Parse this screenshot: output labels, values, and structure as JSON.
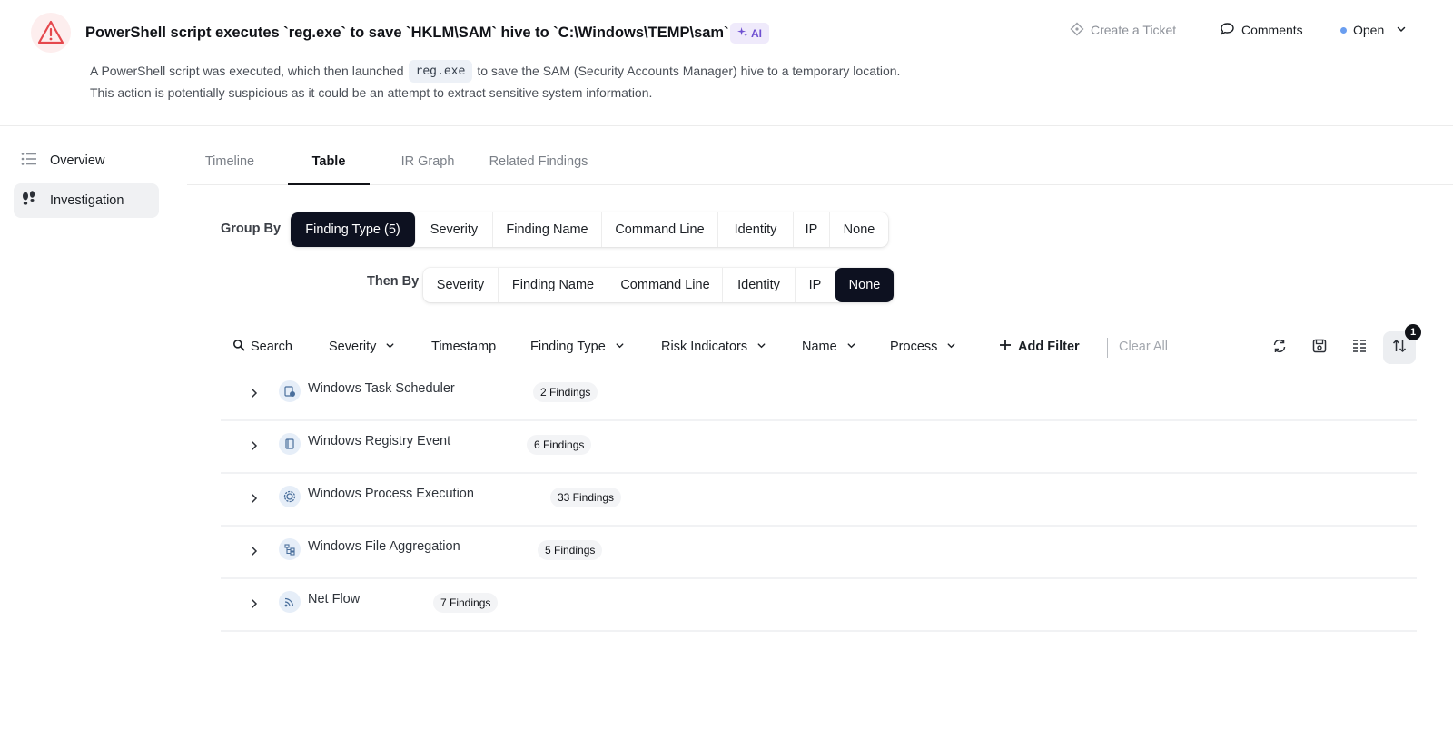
{
  "header": {
    "title": "PowerShell script executes `reg.exe` to save `HKLM\\SAM` hive to `C:\\Windows\\TEMP\\sam`",
    "ai_badge": "AI",
    "description_line1_pre": "A PowerShell script was executed, which then launched",
    "description_code": "reg.exe",
    "description_line1_post": "to save the SAM (Security Accounts Manager) hive to a temporary location.",
    "description_line2": "This action is potentially suspicious as it could be an attempt to extract sensitive system information.",
    "create_ticket": "Create a Ticket",
    "comments": "Comments",
    "status": "Open",
    "status_color": "#6a9ef0",
    "alert_color": "#e5484d"
  },
  "nav": {
    "items": [
      {
        "label": "Overview",
        "icon": "list-icon"
      },
      {
        "label": "Investigation",
        "icon": "footprints-icon",
        "active": true
      }
    ]
  },
  "tabs": [
    {
      "label": "Timeline"
    },
    {
      "label": "Table",
      "active": true
    },
    {
      "label": "IR Graph"
    },
    {
      "label": "Related Findings"
    }
  ],
  "group_by": {
    "label": "Group By",
    "options": [
      "Finding Type (5)",
      "Severity",
      "Finding Name",
      "Command Line",
      "Identity",
      "IP",
      "None"
    ],
    "selected": "Finding Type (5)"
  },
  "then_by": {
    "label": "Then By",
    "options": [
      "Severity",
      "Finding Name",
      "Command Line",
      "Identity",
      "IP",
      "None"
    ],
    "selected": "None"
  },
  "filters": {
    "search": "Search",
    "severity": "Severity",
    "timestamp": "Timestamp",
    "finding_type": "Finding Type",
    "risk_indicators": "Risk Indicators",
    "name": "Name",
    "process": "Process",
    "add_filter": "Add Filter",
    "clear_all": "Clear All",
    "sort_badge": "1"
  },
  "rows": [
    {
      "name": "Windows Task Scheduler",
      "count": "2 Findings",
      "icon": "task-scheduler-icon"
    },
    {
      "name": "Windows Registry Event",
      "count": "6 Findings",
      "icon": "registry-icon"
    },
    {
      "name": "Windows Process Execution",
      "count": "33 Findings",
      "icon": "process-gear-icon"
    },
    {
      "name": "Windows File Aggregation",
      "count": "5 Findings",
      "icon": "file-tree-icon"
    },
    {
      "name": "Net Flow",
      "count": "7 Findings",
      "icon": "netflow-icon"
    }
  ]
}
